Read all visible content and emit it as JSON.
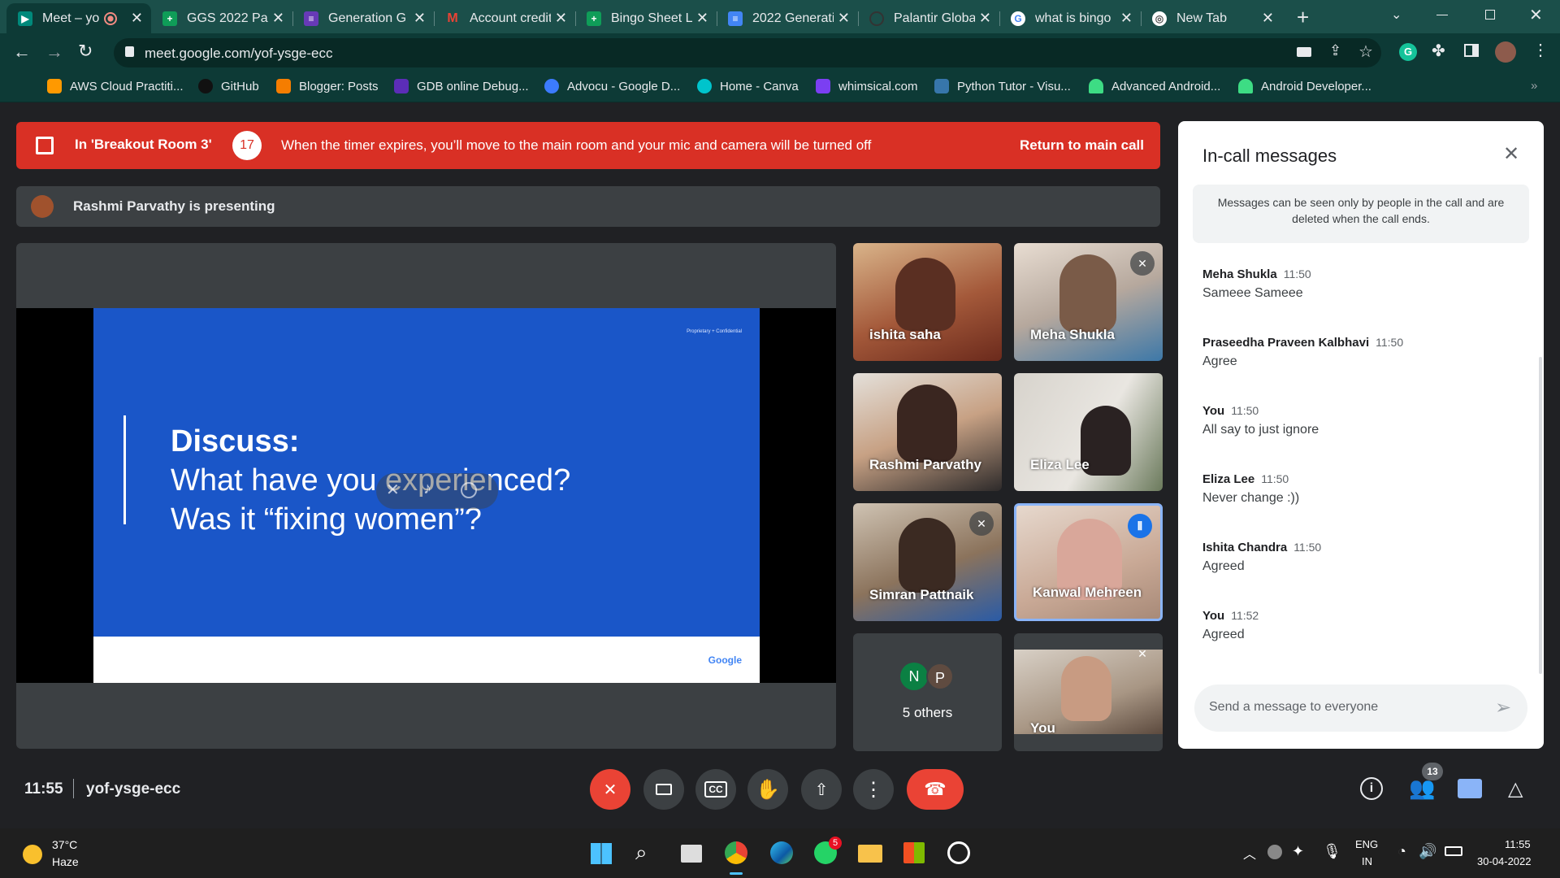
{
  "browser": {
    "tabs": [
      {
        "label": "Meet – yo",
        "fav": "meet-icon",
        "color": "#00897b",
        "active": true
      },
      {
        "label": "GGS 2022 Pa",
        "fav": "sheets-icon",
        "color": "#0f9d58"
      },
      {
        "label": "Generation G",
        "fav": "forms-icon",
        "color": "#673ab7"
      },
      {
        "label": "Account credit",
        "fav": "gmail-icon",
        "color": "#ea4335"
      },
      {
        "label": "Bingo Sheet Li",
        "fav": "sheets-icon",
        "color": "#0f9d58"
      },
      {
        "label": "2022 Generati",
        "fav": "docs-icon",
        "color": "#4285f4"
      },
      {
        "label": "Palantir Globa",
        "fav": "palantir-icon",
        "color": "#222"
      },
      {
        "label": "what is bingo",
        "fav": "google-icon",
        "color": "#fff"
      },
      {
        "label": "New Tab",
        "fav": "chrome-icon",
        "color": "#fff"
      }
    ],
    "url": "meet.google.com/yof-ysge-ecc",
    "bookmarks": [
      {
        "label": "AWS Cloud Practiti...",
        "color": "#ff9900"
      },
      {
        "label": "GitHub",
        "color": "#24292e"
      },
      {
        "label": "Blogger: Posts",
        "color": "#f57d00"
      },
      {
        "label": "GDB online Debug...",
        "color": "#5b2db7"
      },
      {
        "label": "Advocu - Google D...",
        "color": "#3c7bfd"
      },
      {
        "label": "Home - Canva",
        "color": "#00c4cc"
      },
      {
        "label": "whimsical.com",
        "color": "#7b3ff2"
      },
      {
        "label": "Python Tutor - Visu...",
        "color": "#3776ab"
      },
      {
        "label": "Advanced Android...",
        "color": "#3ddc84"
      },
      {
        "label": "Android Developer...",
        "color": "#3ddc84"
      }
    ]
  },
  "banner": {
    "room": "In 'Breakout Room 3'",
    "timer": "17",
    "message": "When the timer expires, you’ll move to the main room and your mic and camera will be turned off",
    "return_label": "Return to main call"
  },
  "presenting": "Rashmi Parvathy is presenting",
  "slide": {
    "corner": "Proprietary + Confidential",
    "title": "Discuss:",
    "line1": "What have you experienced?",
    "line2": "Was it “fixing women”?",
    "footer": "Google"
  },
  "participants": [
    {
      "name": "ishita saha",
      "muted": false,
      "bg": "#8a4a2e"
    },
    {
      "name": "Meha Shukla",
      "muted": true,
      "bg": "#b9a89a"
    },
    {
      "name": "Rashmi Parvathy",
      "muted": false,
      "bg": "#b08a6a"
    },
    {
      "name": "Eliza Lee",
      "muted": false,
      "bg": "#c8c4bc"
    },
    {
      "name": "Simran Pattnaik",
      "muted": true,
      "bg": "#8f7a62"
    },
    {
      "name": "Kanwal Mehreen",
      "muted": false,
      "bg": "#c9a996",
      "speaking": true
    },
    {
      "name": "You",
      "muted": true,
      "bg": "#a89684"
    }
  ],
  "others": {
    "initials": [
      "N",
      "P"
    ],
    "label": "5 others"
  },
  "panel": {
    "title": "In-call messages",
    "notice": "Messages can be seen only by people in the call and are deleted when the call ends.",
    "messages": [
      {
        "sender": "Meha Shukla",
        "time": "11:50",
        "text": "Sameee Sameee"
      },
      {
        "sender": "Praseedha Praveen Kalbhavi",
        "time": "11:50",
        "text": "Agree"
      },
      {
        "sender": "You",
        "time": "11:50",
        "text": "All say to just ignore"
      },
      {
        "sender": "Eliza Lee",
        "time": "11:50",
        "text": "Never change :))"
      },
      {
        "sender": "Ishita Chandra",
        "time": "11:50",
        "text": "Agreed"
      },
      {
        "sender": "You",
        "time": "11:52",
        "text": "Agreed"
      }
    ],
    "input_placeholder": "Send a message to everyone"
  },
  "bottom": {
    "time": "11:55",
    "meeting_code": "yof-ysge-ecc",
    "people_count": "13"
  },
  "taskbar": {
    "temp": "37°C",
    "weather": "Haze",
    "whatsapp_badge": "5",
    "lang1": "ENG",
    "lang2": "IN",
    "clock_time": "11:55",
    "clock_date": "30-04-2022"
  }
}
